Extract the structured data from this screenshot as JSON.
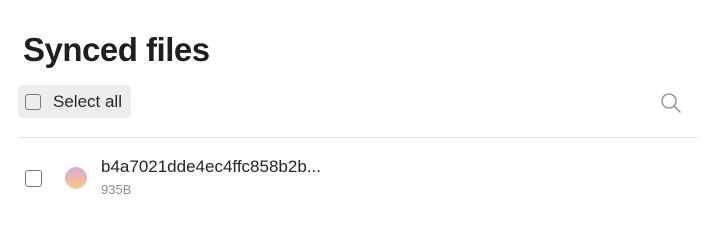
{
  "header": {
    "title": "Synced files"
  },
  "toolbar": {
    "select_all_label": "Select all",
    "search_icon": "search-icon"
  },
  "files": [
    {
      "name": "b4a7021dde4ec4ffc858b2b...",
      "size": "935B",
      "selected": false
    }
  ],
  "colors": {
    "text": "#1f1f1f",
    "muted": "#8f8f8f",
    "select_all_bg": "#ededed",
    "divider": "#e3e3e3"
  }
}
